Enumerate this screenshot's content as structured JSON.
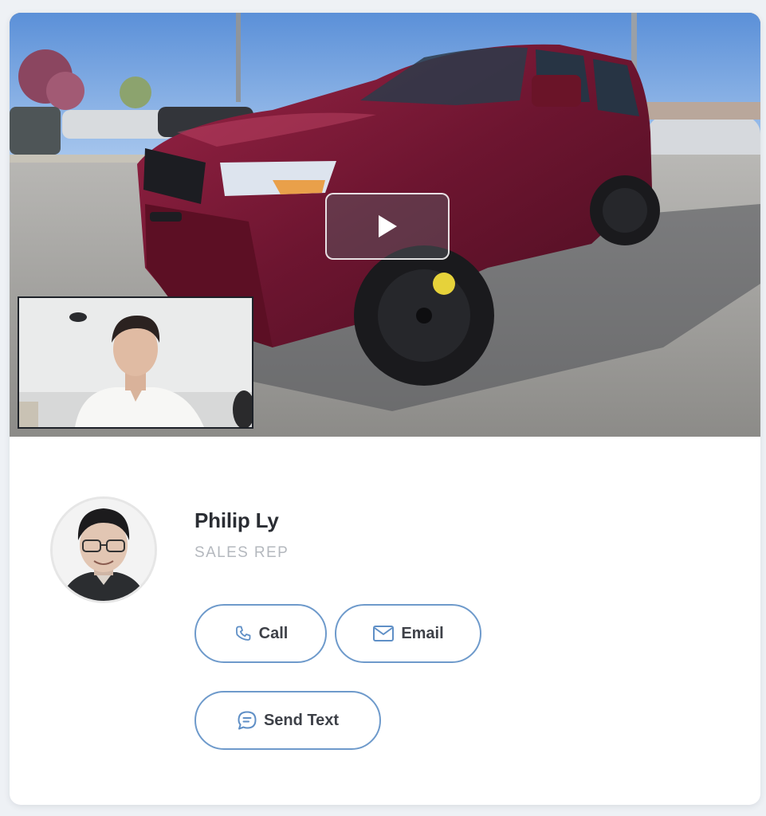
{
  "video": {
    "play_icon": "play-icon"
  },
  "rep": {
    "name": "Philip Ly",
    "title": "SALES REP"
  },
  "actions": {
    "call_label": "Call",
    "call_icon": "phone-icon",
    "email_label": "Email",
    "email_icon": "mail-icon",
    "text_label": "Send Text",
    "text_icon": "chat-bubble-icon"
  },
  "colors": {
    "accent": "#6e9acb",
    "name_text": "#2a2d33",
    "title_text": "#b4b8be",
    "vehicle": "#7a1730"
  }
}
